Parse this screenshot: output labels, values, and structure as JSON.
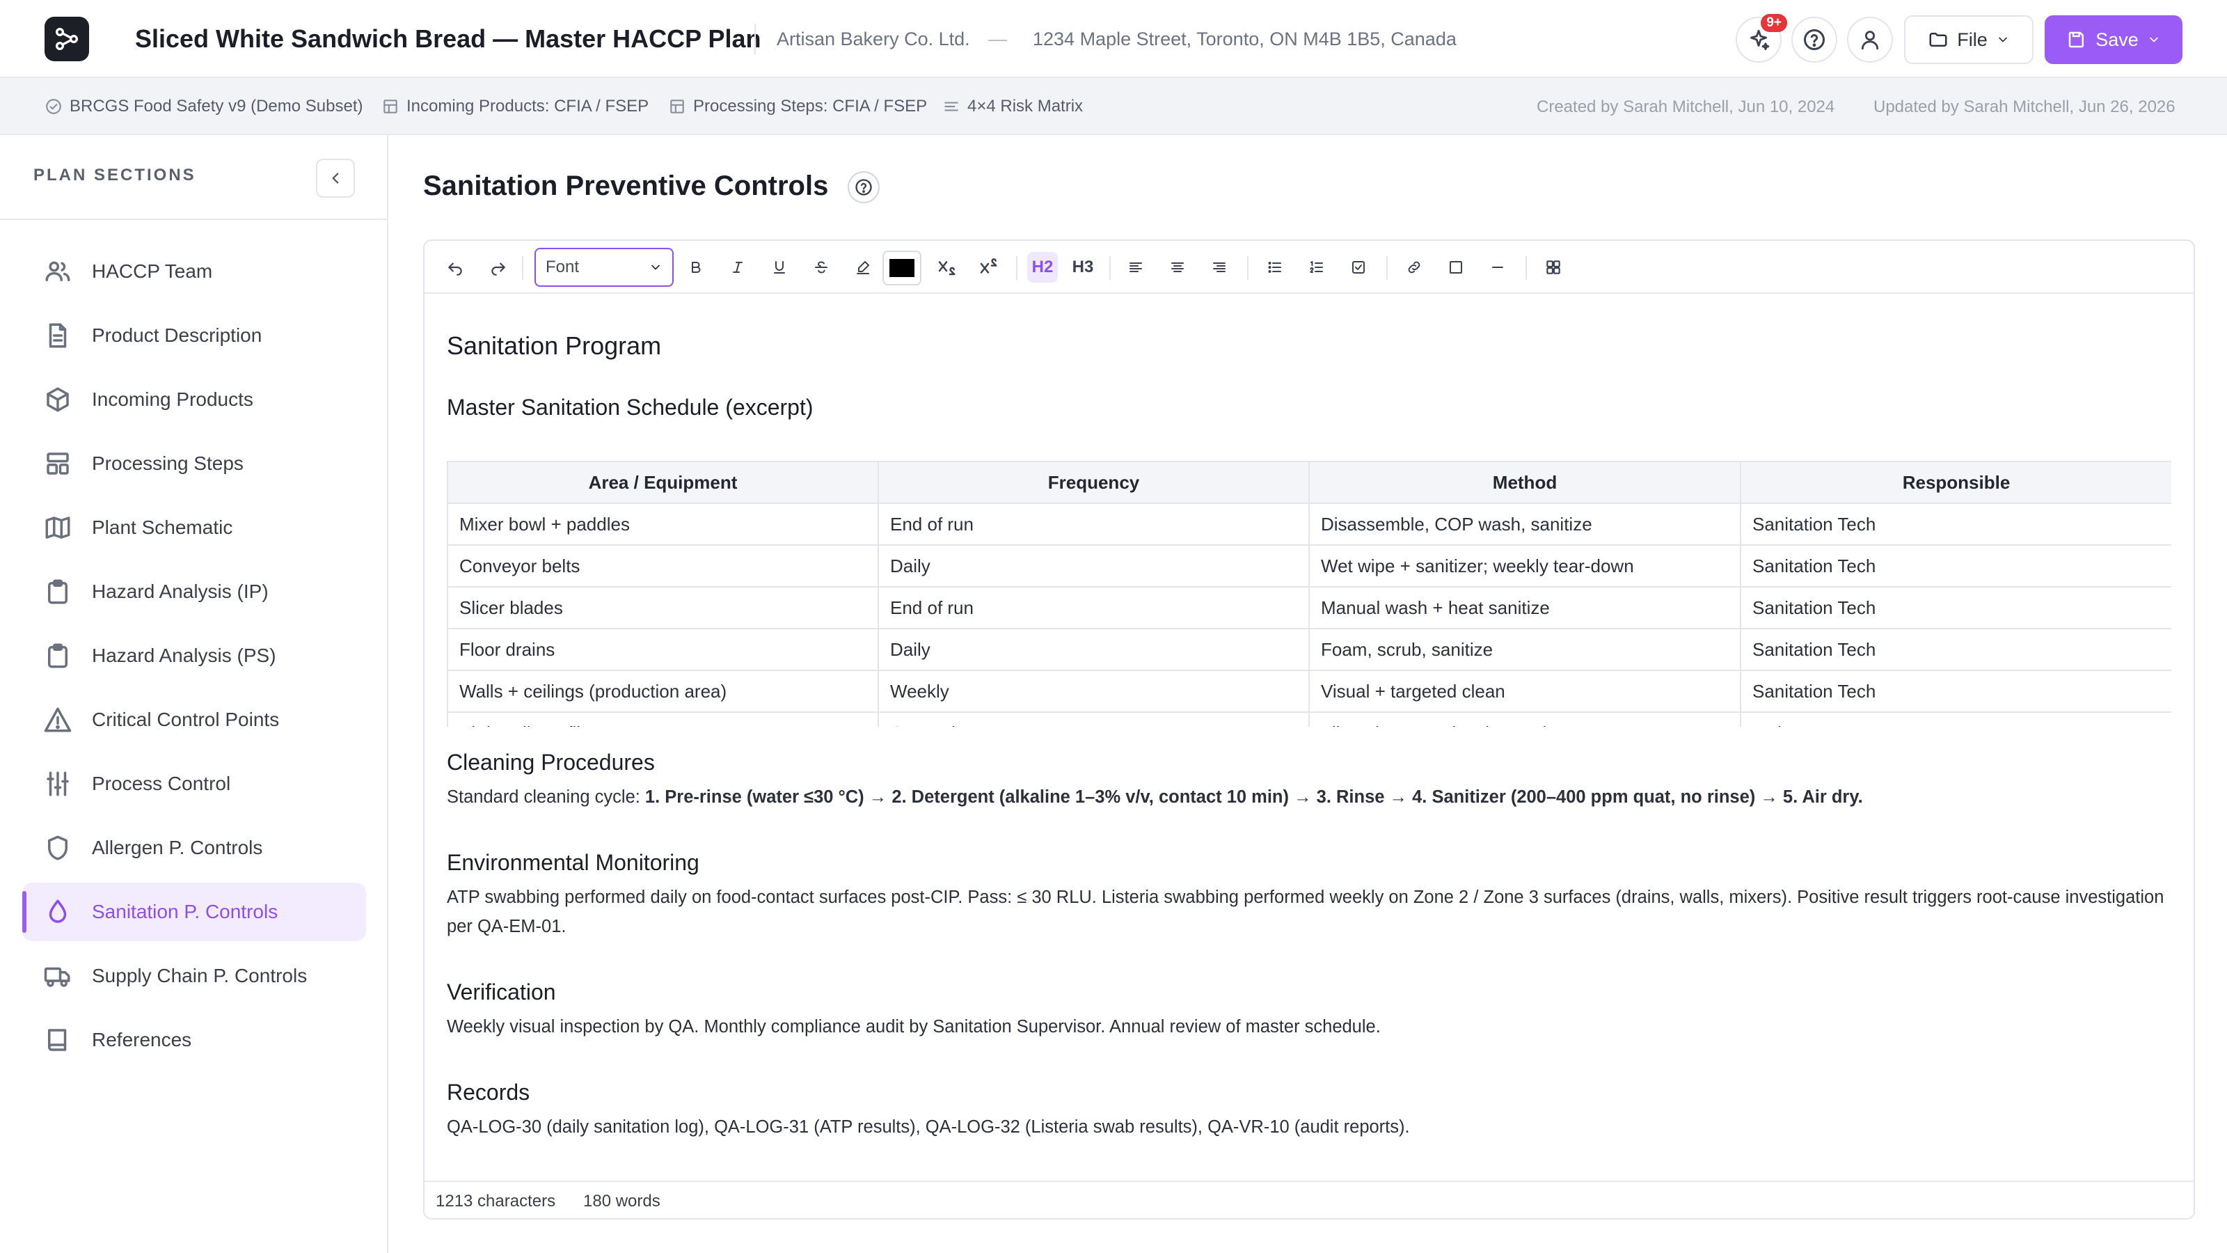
{
  "header": {
    "title": "Sliced White Sandwich Bread — Master HACCP Plan",
    "company": "Artisan Bakery Co. Ltd.",
    "separator": "—",
    "address": "1234 Maple Street, Toronto, ON M4B 1B5, Canada",
    "notification_badge": "9+",
    "file_label": "File",
    "save_label": "Save",
    "accent_color": "#9b5cf6"
  },
  "subbar": {
    "standard": "BRCGS Food Safety v9 (Demo Subset)",
    "incoming_products": "Incoming Products: CFIA / FSEP",
    "processing_steps": "Processing Steps: CFIA / FSEP",
    "risk_matrix": "4×4 Risk Matrix",
    "created": "Created by Sarah Mitchell, Jun 10, 2024",
    "updated": "Updated by Sarah Mitchell, Jun 26, 2026"
  },
  "sidebar": {
    "title": "PLAN SECTIONS",
    "items": [
      {
        "label": "HACCP Team",
        "icon": "team-icon"
      },
      {
        "label": "Product Description",
        "icon": "document-icon"
      },
      {
        "label": "Incoming Products",
        "icon": "package-icon"
      },
      {
        "label": "Processing Steps",
        "icon": "layout-icon"
      },
      {
        "label": "Plant Schematic",
        "icon": "map-icon"
      },
      {
        "label": "Hazard Analysis (IP)",
        "icon": "clipboard-icon"
      },
      {
        "label": "Hazard Analysis (PS)",
        "icon": "clipboard-icon"
      },
      {
        "label": "Critical Control Points",
        "icon": "warning-icon"
      },
      {
        "label": "Process Control",
        "icon": "sliders-icon"
      },
      {
        "label": "Allergen P. Controls",
        "icon": "shield-icon"
      },
      {
        "label": "Sanitation P. Controls",
        "icon": "droplet-icon",
        "active": true
      },
      {
        "label": "Supply Chain P. Controls",
        "icon": "truck-icon"
      },
      {
        "label": "References",
        "icon": "book-icon"
      }
    ]
  },
  "main": {
    "page_title": "Sanitation Preventive Controls",
    "toolbar": {
      "font_label": "Font",
      "h2": "H2",
      "h3": "H3",
      "color": "#000000"
    },
    "doc": {
      "h2": "Sanitation Program",
      "schedule_heading": "Master Sanitation Schedule (excerpt)",
      "table": {
        "headers": [
          "Area / Equipment",
          "Frequency",
          "Method",
          "Responsible"
        ],
        "rows": [
          [
            "Mixer bowl + paddles",
            "End of run",
            "Disassemble, COP wash, sanitize",
            "Sanitation Tech"
          ],
          [
            "Conveyor belts",
            "Daily",
            "Wet wipe + sanitizer; weekly tear-down",
            "Sanitation Tech"
          ],
          [
            "Slicer blades",
            "End of run",
            "Manual wash + heat sanitize",
            "Sanitation Tech"
          ],
          [
            "Floor drains",
            "Daily",
            "Foam, scrub, sanitize",
            "Sanitation Tech"
          ],
          [
            "Walls + ceilings (production area)",
            "Weekly",
            "Visual + targeted clean",
            "Sanitation Tech"
          ],
          [
            "Air handler + filters",
            "Quarterly",
            "Filter change + duct inspection",
            "Maintenance"
          ]
        ]
      },
      "cleaning_heading": "Cleaning Procedures",
      "cleaning_intro": "Standard cleaning cycle: ",
      "cleaning_steps": "1. Pre-rinse (water ≤30 °C) → 2. Detergent (alkaline 1–3% v/v, contact 10 min) → 3. Rinse → 4. Sanitizer (200–400 ppm quat, no rinse) → 5. Air dry.",
      "env_heading": "Environmental Monitoring",
      "env_text": "ATP swabbing performed daily on food-contact surfaces post-CIP. Pass: ≤ 30 RLU. Listeria swabbing performed weekly on Zone 2 / Zone 3 surfaces (drains, walls, mixers). Positive result triggers root-cause investigation per QA-EM-01.",
      "verification_heading": "Verification",
      "verification_text": "Weekly visual inspection by QA. Monthly compliance audit by Sanitation Supervisor. Annual review of master schedule.",
      "records_heading": "Records",
      "records_text": "QA-LOG-30 (daily sanitation log), QA-LOG-31 (ATP results), QA-LOG-32 (Listeria swab results), QA-VR-10 (audit reports)."
    },
    "status": {
      "characters": "1213 characters",
      "words": "180 words"
    }
  }
}
